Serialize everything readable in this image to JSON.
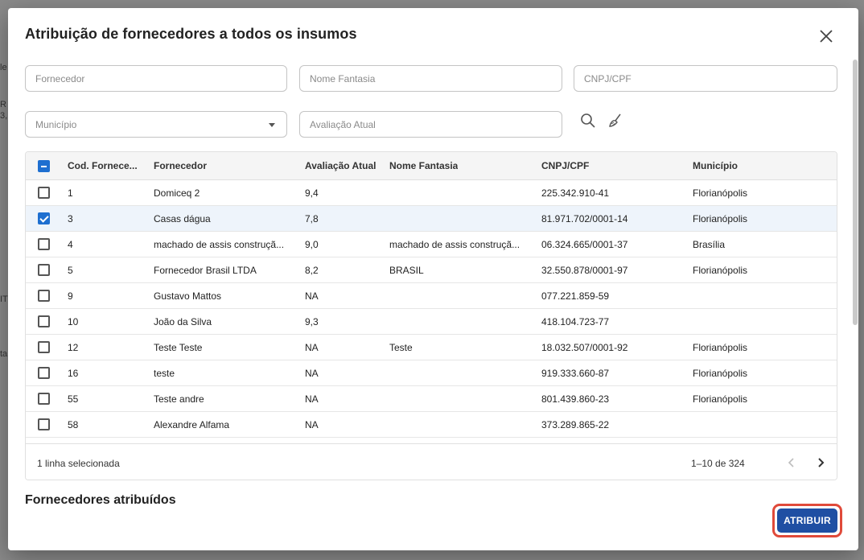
{
  "modal": {
    "title": "Atribuição de fornecedores a todos os insumos"
  },
  "filters": {
    "fornecedor_placeholder": "Fornecedor",
    "nome_fantasia_placeholder": "Nome Fantasia",
    "cnpj_placeholder": "CNPJ/CPF",
    "municipio_placeholder": "Município",
    "avaliacao_placeholder": "Avaliação Atual",
    "search_icon": "search-icon",
    "clear_icon": "broom-icon"
  },
  "table": {
    "columns": [
      "Cod. Fornece...",
      "Fornecedor",
      "Avaliação Atual",
      "Nome Fantasia",
      "CNPJ/CPF",
      "Município"
    ],
    "rows": [
      {
        "cod": "1",
        "fornecedor": "Domiceq 2",
        "avaliacao": "9,4",
        "fantasia": "",
        "cnpj": "225.342.910-41",
        "municipio": "Florianópolis",
        "checked": false
      },
      {
        "cod": "3",
        "fornecedor": "Casas dágua",
        "avaliacao": "7,8",
        "fantasia": "",
        "cnpj": "81.971.702/0001-14",
        "municipio": "Florianópolis",
        "checked": true
      },
      {
        "cod": "4",
        "fornecedor": "machado de assis construçã...",
        "avaliacao": "9,0",
        "fantasia": "machado de assis construçã...",
        "cnpj": "06.324.665/0001-37",
        "municipio": "Brasília",
        "checked": false
      },
      {
        "cod": "5",
        "fornecedor": "Fornecedor Brasil LTDA",
        "avaliacao": "8,2",
        "fantasia": "BRASIL",
        "cnpj": "32.550.878/0001-97",
        "municipio": "Florianópolis",
        "checked": false
      },
      {
        "cod": "9",
        "fornecedor": "Gustavo Mattos",
        "avaliacao": "NA",
        "fantasia": "",
        "cnpj": "077.221.859-59",
        "municipio": "",
        "checked": false
      },
      {
        "cod": "10",
        "fornecedor": "João da Silva",
        "avaliacao": "9,3",
        "fantasia": "",
        "cnpj": "418.104.723-77",
        "municipio": "",
        "checked": false
      },
      {
        "cod": "12",
        "fornecedor": "Teste Teste",
        "avaliacao": "NA",
        "fantasia": "Teste",
        "cnpj": "18.032.507/0001-92",
        "municipio": "Florianópolis",
        "checked": false
      },
      {
        "cod": "16",
        "fornecedor": "teste",
        "avaliacao": "NA",
        "fantasia": "",
        "cnpj": "919.333.660-87",
        "municipio": "Florianópolis",
        "checked": false
      },
      {
        "cod": "55",
        "fornecedor": "Teste andre",
        "avaliacao": "NA",
        "fantasia": "",
        "cnpj": "801.439.860-23",
        "municipio": "Florianópolis",
        "checked": false
      },
      {
        "cod": "58",
        "fornecedor": "Alexandre Alfama",
        "avaliacao": "NA",
        "fantasia": "",
        "cnpj": "373.289.865-22",
        "municipio": "",
        "checked": false
      }
    ],
    "selected_text": "1 linha selecionada",
    "page_range": "1–10 de 324"
  },
  "assigned": {
    "title": "Fornecedores atribuídos"
  },
  "actions": {
    "assign_label": "ATRIBUIR"
  },
  "background": {
    "fragments": [
      "le",
      "R",
      "3,",
      "IT",
      "ta"
    ]
  },
  "colors": {
    "accent": "#1e6fd0",
    "primary_button": "#1f4fa3",
    "highlight_border": "#e04a3a",
    "selected_row": "#eef4fb"
  }
}
